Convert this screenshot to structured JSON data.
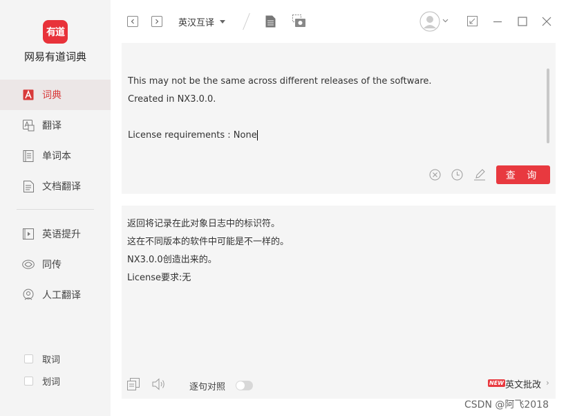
{
  "app": {
    "logo_text": "有道",
    "name": "网易有道词典"
  },
  "sidebar": {
    "items": [
      {
        "label": "词典",
        "icon": "dictionary-icon"
      },
      {
        "label": "翻译",
        "icon": "translate-icon"
      },
      {
        "label": "单词本",
        "icon": "wordbook-icon"
      },
      {
        "label": "文档翻译",
        "icon": "document-translate-icon"
      },
      {
        "label": "英语提升",
        "icon": "english-improve-icon"
      },
      {
        "label": "同传",
        "icon": "simultaneous-icon"
      },
      {
        "label": "人工翻译",
        "icon": "human-translate-icon"
      }
    ],
    "options": [
      {
        "label": "取词",
        "checked": false
      },
      {
        "label": "划词",
        "checked": false
      }
    ]
  },
  "toolbar": {
    "language": "英汉互译"
  },
  "input": {
    "lines": [
      "This may not be the same across different releases of the software.",
      "Created in NX3.0.0.",
      "",
      "License requirements : None"
    ],
    "query_label": "查 询"
  },
  "output": {
    "lines": [
      "返回将记录在此对象日志中的标识符。",
      "这在不同版本的软件中可能是不一样的。",
      "NX3.0.0创造出来的。",
      "License要求:无"
    ],
    "compare_label": "逐句对照",
    "compare_on": false,
    "new_badge": "NEW",
    "essay_label": "英文批改"
  },
  "watermark": "CSDN @阿飞2018",
  "colors": {
    "accent": "#e8393f",
    "sidebar_bg": "#f4f4f4",
    "panel_bg": "#f5f5f5"
  }
}
